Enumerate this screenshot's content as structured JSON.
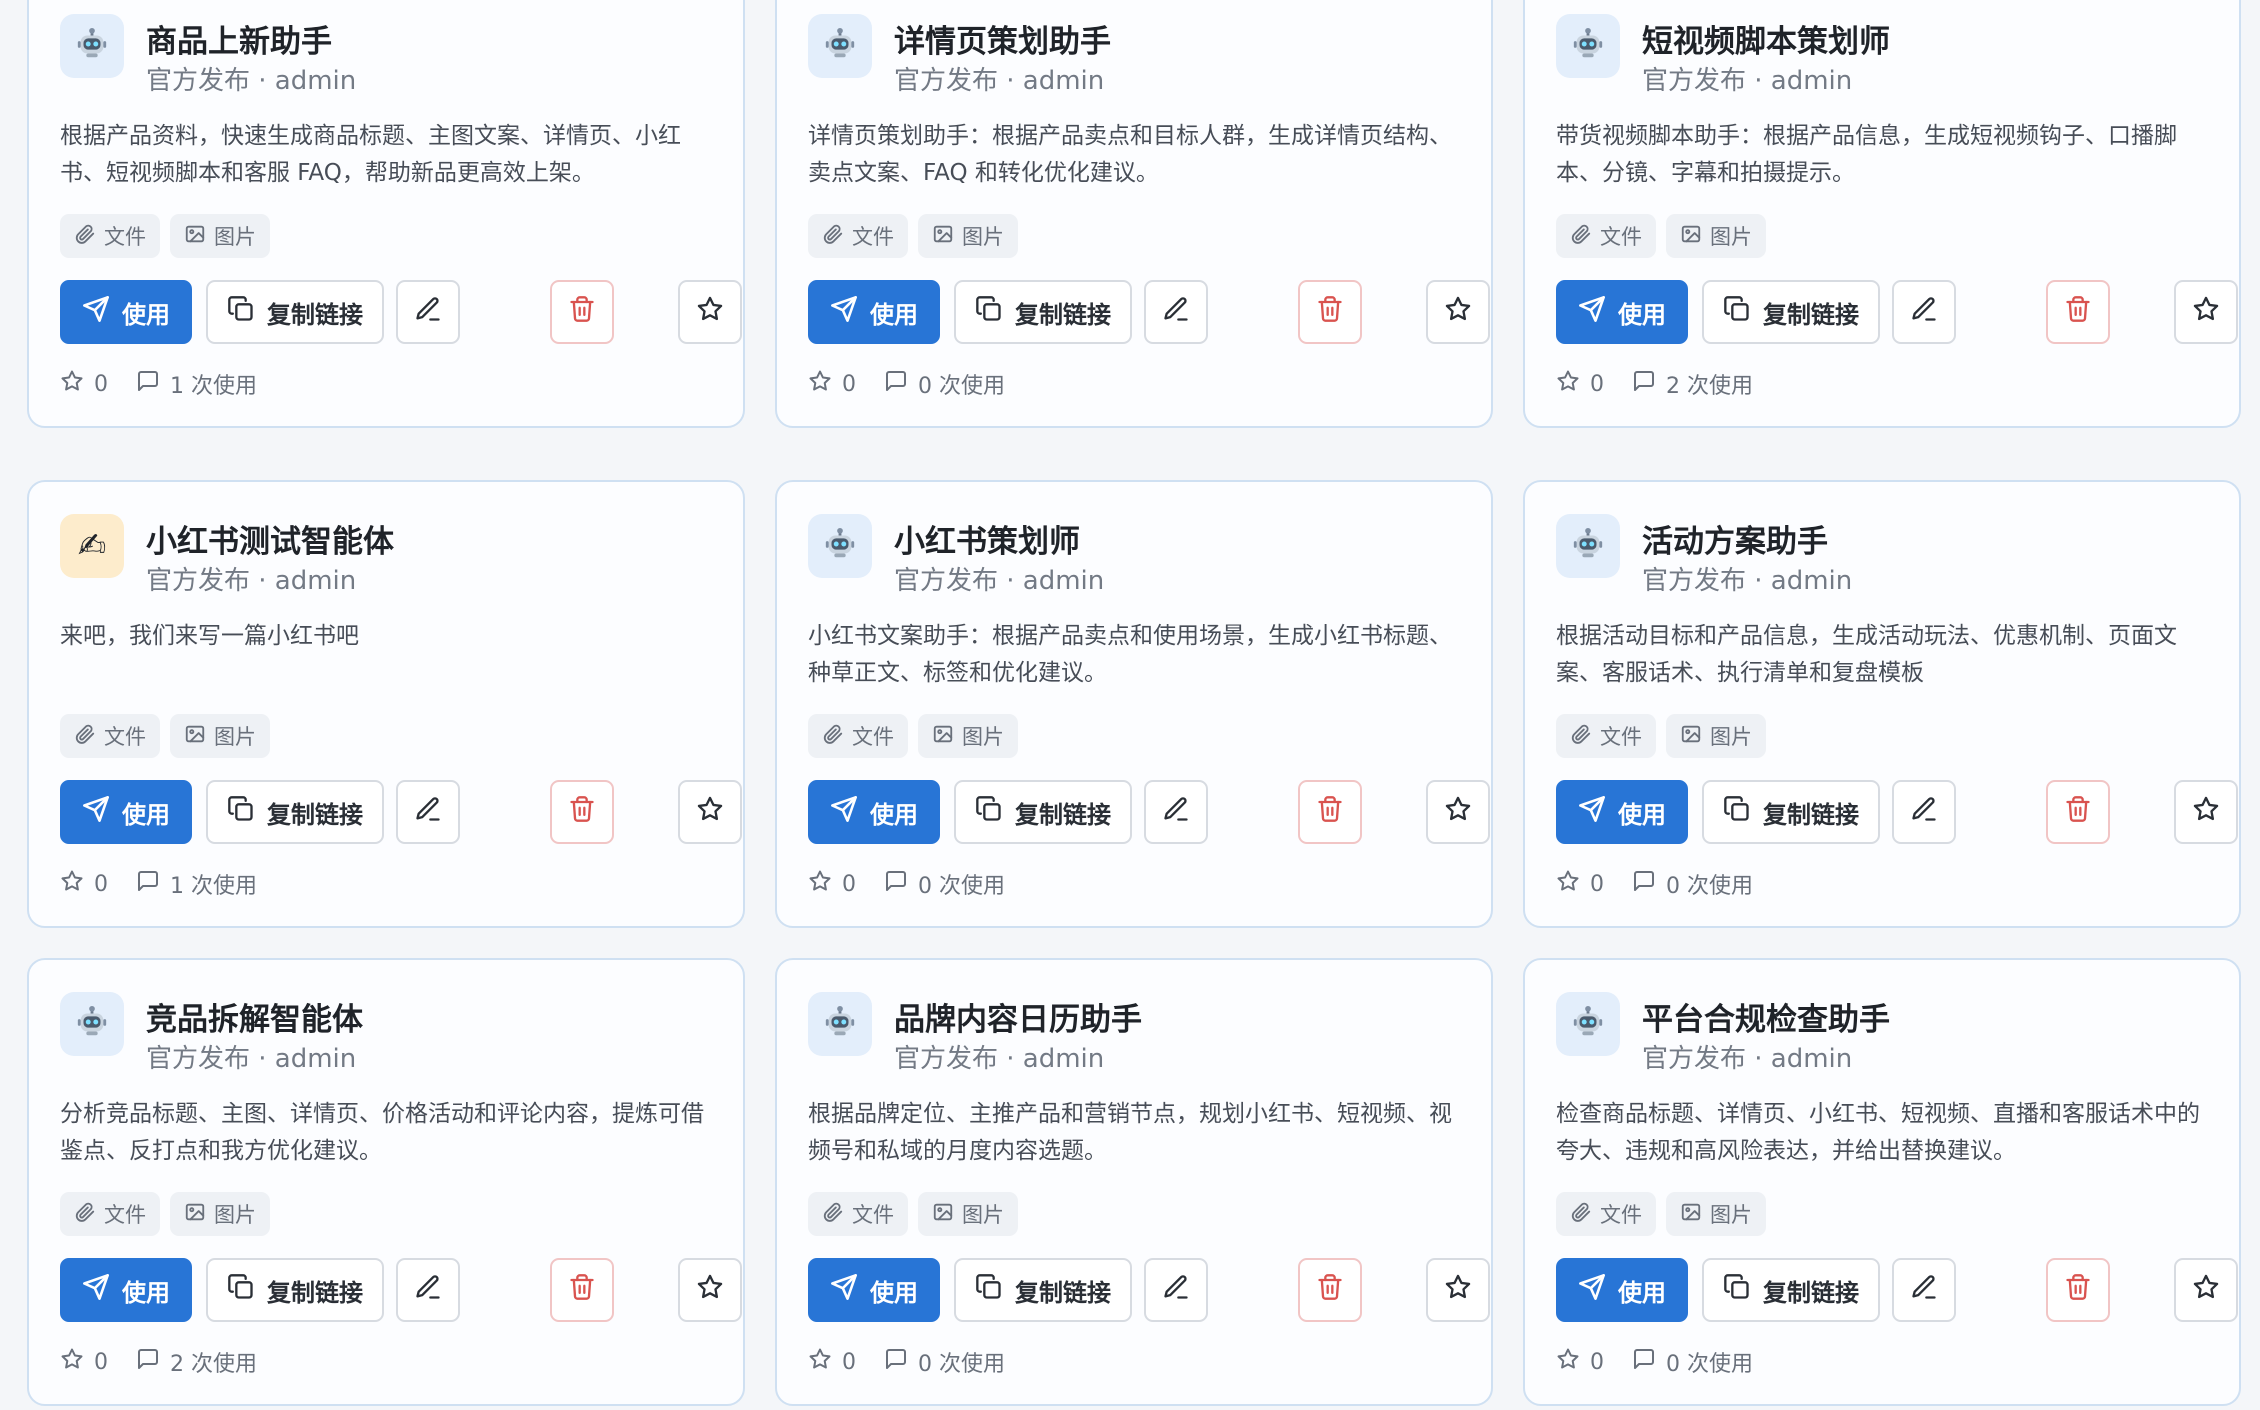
{
  "cards": [
    {
      "title": "商品上新助手",
      "publisher": "官方发布 · admin",
      "description": "根据产品资料，快速生成商品标题、主图文案、详情页、小红书、短视频脚本和客服 FAQ，帮助新品更高效上架。",
      "avatar_icon": "robot-icon",
      "tags": [
        "文件",
        "图片"
      ],
      "use_label": "使用",
      "copy_label": "复制链接",
      "stars": "0",
      "usage": "1 次使用"
    },
    {
      "title": "详情页策划助手",
      "publisher": "官方发布 · admin",
      "description": "详情页策划助手：根据产品卖点和目标人群，生成详情页结构、卖点文案、FAQ 和转化优化建议。",
      "avatar_icon": "robot-icon",
      "tags": [
        "文件",
        "图片"
      ],
      "use_label": "使用",
      "copy_label": "复制链接",
      "stars": "0",
      "usage": "0 次使用"
    },
    {
      "title": "短视频脚本策划师",
      "publisher": "官方发布 · admin",
      "description": "带货视频脚本助手：根据产品信息，生成短视频钩子、口播脚本、分镜、字幕和拍摄提示。",
      "avatar_icon": "robot-icon",
      "tags": [
        "文件",
        "图片"
      ],
      "use_label": "使用",
      "copy_label": "复制链接",
      "stars": "0",
      "usage": "2 次使用"
    },
    {
      "title": "小红书测试智能体",
      "publisher": "官方发布 · admin",
      "description": "来吧，我们来写一篇小红书吧",
      "avatar_icon": "writing-hand-icon",
      "avatar_glyph": "✍",
      "tags": [
        "文件",
        "图片"
      ],
      "use_label": "使用",
      "copy_label": "复制链接",
      "stars": "0",
      "usage": "1 次使用"
    },
    {
      "title": "小红书策划师",
      "publisher": "官方发布 · admin",
      "description": "小红书文案助手：根据产品卖点和使用场景，生成小红书标题、种草正文、标签和优化建议。",
      "avatar_icon": "robot-icon",
      "tags": [
        "文件",
        "图片"
      ],
      "use_label": "使用",
      "copy_label": "复制链接",
      "stars": "0",
      "usage": "0 次使用"
    },
    {
      "title": "活动方案助手",
      "publisher": "官方发布 · admin",
      "description": "根据活动目标和产品信息，生成活动玩法、优惠机制、页面文案、客服话术、执行清单和复盘模板",
      "avatar_icon": "robot-icon",
      "tags": [
        "文件",
        "图片"
      ],
      "use_label": "使用",
      "copy_label": "复制链接",
      "stars": "0",
      "usage": "0 次使用"
    },
    {
      "title": "竞品拆解智能体",
      "publisher": "官方发布 · admin",
      "description": "分析竞品标题、主图、详情页、价格活动和评论内容，提炼可借鉴点、反打点和我方优化建议。",
      "avatar_icon": "robot-icon",
      "tags": [
        "文件",
        "图片"
      ],
      "use_label": "使用",
      "copy_label": "复制链接",
      "stars": "0",
      "usage": "2 次使用"
    },
    {
      "title": "品牌内容日历助手",
      "publisher": "官方发布 · admin",
      "description": "根据品牌定位、主推产品和营销节点，规划小红书、短视频、视频号和私域的月度内容选题。",
      "avatar_icon": "robot-icon",
      "tags": [
        "文件",
        "图片"
      ],
      "use_label": "使用",
      "copy_label": "复制链接",
      "stars": "0",
      "usage": "0 次使用"
    },
    {
      "title": "平台合规检查助手",
      "publisher": "官方发布 · admin",
      "description": "检查商品标题、详情页、小红书、短视频、直播和客服话术中的夸大、违规和高风险表达，并给出替换建议。",
      "avatar_icon": "robot-icon",
      "tags": [
        "文件",
        "图片"
      ],
      "use_label": "使用",
      "copy_label": "复制链接",
      "stars": "0",
      "usage": "0 次使用"
    }
  ],
  "colors": {
    "primary": "#2875d6",
    "danger": "#d9534f",
    "card_border": "#cfe0f2"
  }
}
